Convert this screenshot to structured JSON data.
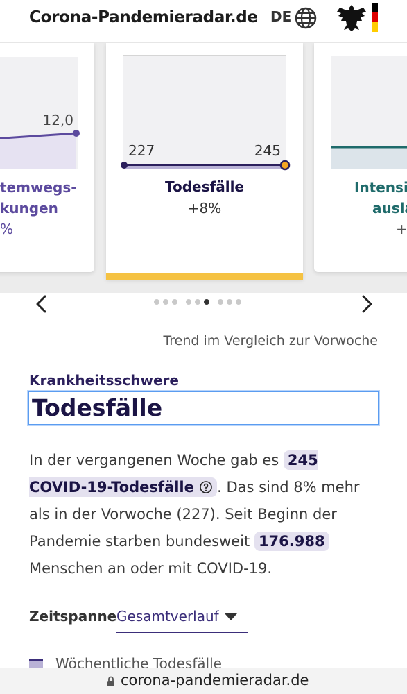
{
  "header": {
    "site_title": "Corona-Pandemieradar.de",
    "language": "DE",
    "icons": [
      "globe-icon",
      "federal-eagle-logo"
    ],
    "flag_colors": [
      "#000000",
      "#dd0000",
      "#ffcc00"
    ]
  },
  "carousel": {
    "cards": [
      {
        "label_line1": "temwegs-",
        "label_line2": "kungen",
        "change": "%",
        "value_end": "12,0",
        "color": "#5c4a9e"
      },
      {
        "label": "Todesfälle",
        "change": "+8%",
        "value_start": "227",
        "value_end": "245",
        "color": "#2b1f5c",
        "selected": true
      },
      {
        "label_line1": "Intensi",
        "label_line2": "ausla",
        "change": "+",
        "color": "#1f6b6b"
      }
    ],
    "dot_count": 10,
    "active_dot": 5,
    "accent_color": "#f5c242"
  },
  "trend_note": "Trend im Vergleich zur Vorwoche",
  "section": {
    "kicker": "Krankheitsschwere",
    "title": "Todesfälle"
  },
  "paragraph": {
    "part1": "In der vergangenen Woche gab es ",
    "chip1": "245 COVID-19-Todesfälle",
    "part2": ". Das sind 8% mehr als in der Vorwoche (227). Seit Beginn der Pandemie starben bundesweit ",
    "chip2": "176.988",
    "part3": " Menschen an oder mit COVID-19."
  },
  "timespan": {
    "label": "Zeitspanne",
    "selected": "Gesamtverlauf"
  },
  "legend": {
    "item": "Wöchentliche Todesfälle"
  },
  "browser": {
    "url": "corona-pandemieradar.de"
  }
}
